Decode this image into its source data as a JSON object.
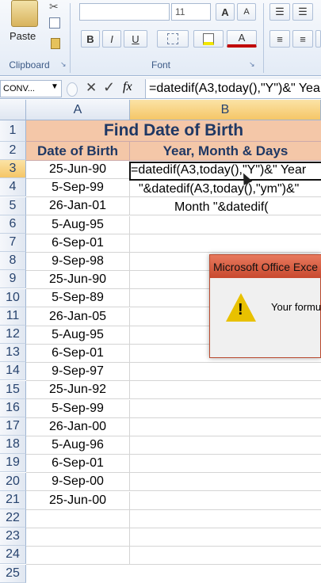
{
  "ribbon": {
    "paste_label": "Paste",
    "clipboard_label": "Clipboard",
    "font_label": "Font",
    "font_size": "11",
    "bold": "B",
    "italic": "I",
    "underline": "U",
    "grow_font": "A",
    "shrink_font": "A",
    "font_color": "A"
  },
  "formula_bar": {
    "name_box": "CONV...",
    "cancel": "✕",
    "enter": "✓",
    "fx": "fx",
    "formula": "=datedif(A3,today(),\"Y\")&\" Yea"
  },
  "columns": [
    "A",
    "B"
  ],
  "rows": [
    "1",
    "2",
    "3",
    "4",
    "5",
    "6",
    "7",
    "8",
    "9",
    "10",
    "11",
    "12",
    "13",
    "14",
    "15",
    "16",
    "17",
    "18",
    "19",
    "20",
    "21",
    "22",
    "23",
    "24",
    "25"
  ],
  "sheet": {
    "title": "Find Date of Birth",
    "header_a": "Date of Birth",
    "header_b": "Year, Month & Days",
    "dates": [
      "25-Jun-90",
      "5-Sep-99",
      "26-Jan-01",
      "5-Aug-95",
      "6-Sep-01",
      "9-Sep-98",
      "25-Jun-90",
      "5-Sep-89",
      "26-Jan-05",
      "5-Aug-95",
      "6-Sep-01",
      "9-Sep-97",
      "25-Jun-92",
      "5-Sep-99",
      "26-Jan-00",
      "5-Aug-96",
      "6-Sep-01",
      "9-Sep-00",
      "25-Jun-00"
    ],
    "formula_line1": "=datedif(A3,today(),\"Y\")&\" Year",
    "formula_line2": "\"&datedif(A3,today(),\"ym\")&\"",
    "formula_line3": "Month \"&datedif("
  },
  "dialog": {
    "title": "Microsoft Office Exce",
    "message": "Your formu"
  }
}
